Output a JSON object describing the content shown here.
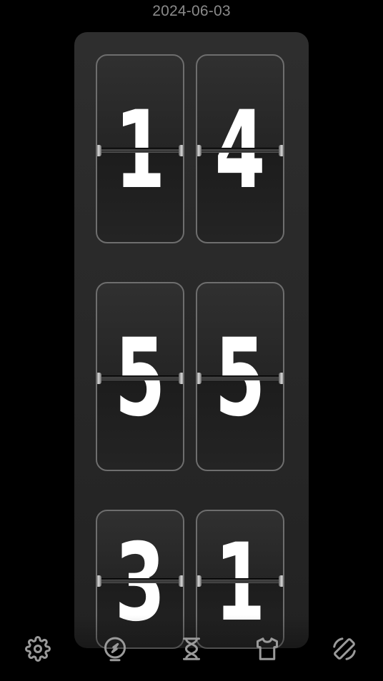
{
  "date_label": "2024-06-03",
  "clock": {
    "hours": [
      "1",
      "4"
    ],
    "minutes": [
      "5",
      "5"
    ],
    "seconds": [
      "3",
      "1"
    ]
  },
  "toolbar": {
    "items": [
      {
        "icon": "gear-icon"
      },
      {
        "icon": "compass-icon"
      },
      {
        "icon": "hourglass-icon"
      },
      {
        "icon": "shirt-icon"
      },
      {
        "icon": "rotate-screen-icon"
      }
    ]
  },
  "colors": {
    "background": "#000000",
    "panel": "#2a2a2a",
    "card_border": "#6e6e6e",
    "digit": "#ffffff",
    "date_text": "#8a8a8a",
    "icon": "#9a9a9a"
  }
}
